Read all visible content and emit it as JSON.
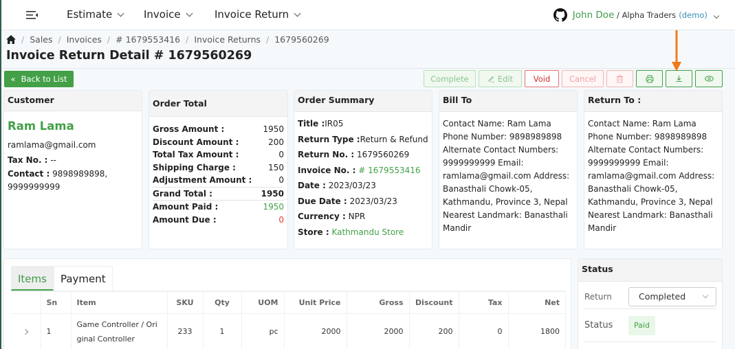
{
  "nav": {
    "items": [
      {
        "label": "Estimate"
      },
      {
        "label": "Invoice"
      },
      {
        "label": "Invoice Return"
      }
    ],
    "user": {
      "name": "John Doe",
      "separator": " / ",
      "org": "Alpha Traders",
      "badge": "(demo)"
    }
  },
  "breadcrumb": [
    "Sales",
    "Invoices",
    "# 1679553416",
    "Invoice Returns",
    "1679560269"
  ],
  "page_title": "Invoice Return Detail # 1679560269",
  "toolbar": {
    "back": "Back to List",
    "complete": "Complete",
    "edit": "Edit",
    "void": "Void",
    "cancel": "Cancel",
    "icons": [
      "trash-icon",
      "print-icon",
      "download-icon",
      "eye-icon"
    ]
  },
  "customer": {
    "heading": "Customer",
    "name": "Ram Lama",
    "email": "ramlama@gmail.com",
    "tax_label": "Tax No. :",
    "tax_value": "--",
    "contact_label": "Contact :",
    "contact_value": "9898989898, 9999999999"
  },
  "order_total": {
    "heading": "Order Total",
    "rows": [
      {
        "label": "Gross Amount :",
        "value": "1950"
      },
      {
        "label": "Discount Amount :",
        "value": "200"
      },
      {
        "label": "Total Tax Amount :",
        "value": "0"
      },
      {
        "label": "Shipping Charge :",
        "value": "150"
      },
      {
        "label": "Adjustment Amount :",
        "value": "0"
      },
      {
        "label": "Grand Total :",
        "value": "1950"
      },
      {
        "label": "Amount Paid :",
        "value": "1950"
      },
      {
        "label": "Amount Due :",
        "value": "0"
      }
    ]
  },
  "order_summary": {
    "heading": "Order Summary",
    "title_label": "Title :",
    "title_value": "IR05",
    "return_type_label": "Return Type :",
    "return_type_value": "Return & Refund",
    "return_no_label": "Return No. :",
    "return_no_value": "1679560269",
    "invoice_no_label": "Invoice No. :",
    "invoice_no_value": "# 1679553416",
    "date_label": "Date :",
    "date_value": "2023/03/23",
    "due_date_label": "Due Date :",
    "due_date_value": "2023/03/23",
    "currency_label": "Currency :",
    "currency_value": "NPR",
    "store_label": "Store :",
    "store_value": "Kathmandu Store"
  },
  "bill_to": {
    "heading": "Bill To",
    "text": "Contact Name: Ram Lama Phone Number: 9898989898 Alternate Contact Numbers: 9999999999 Email: ramlama@gmail.com Address: Banasthali Chowk-05, Kathmandu, Province 3, Nepal Nearest Landmark: Banasthali Mandir"
  },
  "return_to": {
    "heading": "Return To :",
    "text": "Contact Name: Ram Lama Phone Number: 9898989898 Alternate Contact Numbers: 9999999999 Email: ramlama@gmail.com Address: Banasthali Chowk-05, Kathmandu, Province 3, Nepal Nearest Landmark: Banasthali Mandir"
  },
  "items_tabs": [
    {
      "label": "Items",
      "active": true
    },
    {
      "label": "Payment",
      "active": false
    }
  ],
  "items_table": {
    "columns": [
      "",
      "Sn",
      "Item",
      "SKU",
      "Qty",
      "UOM",
      "Unit Price",
      "Gross",
      "Discount",
      "Tax",
      "Net"
    ],
    "rows": [
      {
        "sn": "1",
        "item": "Game Controller / Original Controller",
        "sku": "233",
        "qty": "1",
        "uom": "pc",
        "unit_price": "2000",
        "gross": "2000",
        "discount": "200",
        "tax": "0",
        "net": "1800"
      }
    ]
  },
  "status": {
    "heading": "Status",
    "return_label": "Return",
    "return_value": "Completed",
    "status_label": "Status",
    "status_value": "Paid"
  },
  "colors": {
    "accent_green": "#43a047",
    "danger_red": "#e53935",
    "annotation_arrow": "#f07a1a"
  }
}
